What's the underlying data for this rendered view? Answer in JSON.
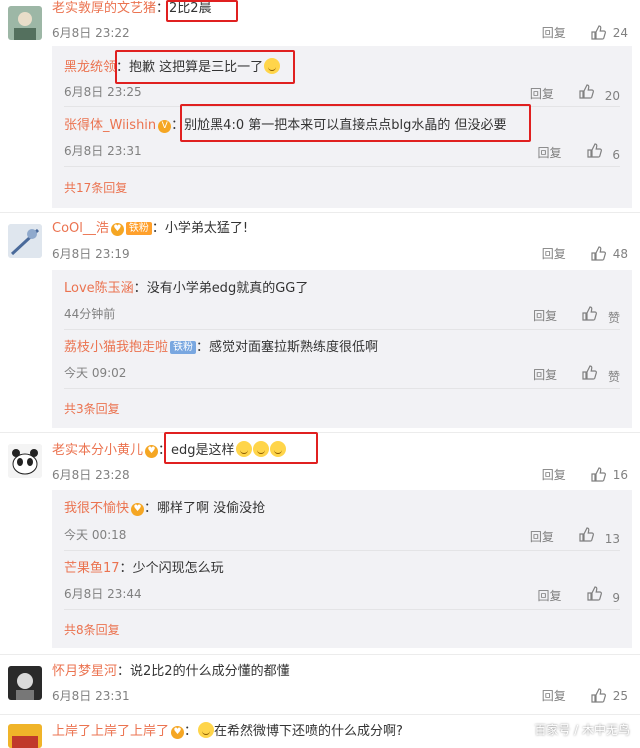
{
  "colors": {
    "username": "#eb7350",
    "meta": "#808080",
    "reply_bg": "#f2f2f5",
    "highlight_box": "#e02020"
  },
  "comments": [
    {
      "user": "老实敦厚的文艺猪",
      "text": "2比2晨",
      "time": "6月8日 23:22",
      "reply_label": "回复",
      "likes": "24",
      "replies": [
        {
          "user": "黑龙统领",
          "text": "抱歉 这把算是三比一了",
          "time": "6月8日 23:25",
          "reply_label": "回复",
          "likes": "20"
        },
        {
          "user": "张得体_Wiishin",
          "text": "别尬黑4:0 第一把本来可以直接点点blg水晶的 但没必要",
          "time": "6月8日 23:31",
          "reply_label": "回复",
          "likes": "6"
        }
      ],
      "more": "共17条回复"
    },
    {
      "user": "CoOl__浩",
      "badge": "铁粉",
      "text": "小学弟太猛了!",
      "time": "6月8日 23:19",
      "reply_label": "回复",
      "likes": "48",
      "replies": [
        {
          "user": "Love陈玉涵",
          "text": "没有小学弟edg就真的GG了",
          "time": "44分钟前",
          "reply_label": "回复",
          "likes": "赞"
        },
        {
          "user": "荔枝小猫我抱走啦",
          "badge": "铁粉",
          "text": "感觉对面塞拉斯熟练度很低啊",
          "time": "今天 09:02",
          "reply_label": "回复",
          "likes": "赞"
        }
      ],
      "more": "共3条回复"
    },
    {
      "user": "老实本分小黄儿",
      "text": "edg是这样",
      "time": "6月8日 23:28",
      "reply_label": "回复",
      "likes": "16",
      "replies": [
        {
          "user": "我很不愉快",
          "text": "哪样了啊  没偷没抢",
          "time": "今天 00:18",
          "reply_label": "回复",
          "likes": "13"
        },
        {
          "user": "芒果鱼17",
          "text": "少个闪现怎么玩",
          "time": "6月8日 23:44",
          "reply_label": "回复",
          "likes": "9"
        }
      ],
      "more": "共8条回复"
    },
    {
      "user": "怀月梦星河",
      "text": "说2比2的什么成分懂的都懂",
      "time": "6月8日 23:31",
      "reply_label": "回复",
      "likes": "25"
    },
    {
      "user": "上岸了上岸了上岸了",
      "text": "在希然微博下还喷的什么成分啊?"
    }
  ],
  "icons": {
    "like": "thumbs-up-icon",
    "vip": "verified-v-icon"
  },
  "watermark": "百家号 / 木中无鸟"
}
